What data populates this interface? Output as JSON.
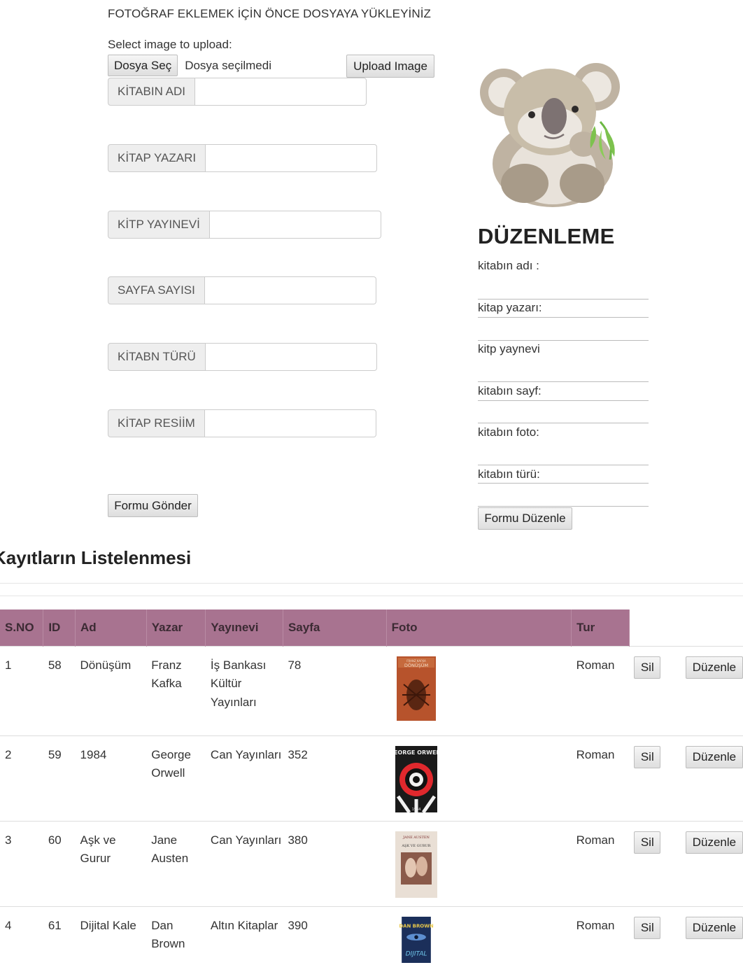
{
  "upload": {
    "note": "FOTOĞRAF EKLEMEK İÇİN ÖNCE DOSYAYA YÜKLEYİNİZ",
    "label": "Select image to upload:",
    "choose_label": "Dosya Seç",
    "file_status": "Dosya seçilmedi",
    "upload_button": "Upload Image"
  },
  "form": {
    "fields": [
      {
        "label": "KİTABIN ADI",
        "value": ""
      },
      {
        "label": "KİTAP YAZARI",
        "value": ""
      },
      {
        "label": "KİTP YAYINEVİ",
        "value": ""
      },
      {
        "label": "SAYFA SAYISI",
        "value": ""
      },
      {
        "label": "KİTABN TÜRÜ",
        "value": ""
      },
      {
        "label": "KİTAP RESİİM",
        "value": ""
      }
    ],
    "submit_label": "Formu Gönder"
  },
  "edit": {
    "title": "DÜZENLEME",
    "labels": [
      "kitabın adı :",
      "kitap yazarı:",
      "kitp yaynevi",
      "kitabın sayf:",
      "kitabın foto:",
      "kitabın türü:"
    ],
    "button_label": "Formu Düzenle"
  },
  "list": {
    "title": "Kayıtların Listelenmesi",
    "columns": [
      "S.NO",
      "ID",
      "Ad",
      "Yazar",
      "Yayınevi",
      "Sayfa",
      "Foto",
      "Tur"
    ],
    "delete_label": "Sil",
    "edit_label": "Düzenle",
    "rows": [
      {
        "sno": "1",
        "id": "58",
        "ad": "Dönüşüm",
        "yazar": "Franz Kafka",
        "yayinevi": "İş Bankası Kültür Yayınları",
        "sayfa": "78",
        "tur": "Roman"
      },
      {
        "sno": "2",
        "id": "59",
        "ad": "1984",
        "yazar": "George Orwell",
        "yayinevi": "Can Yayınları",
        "sayfa": "352",
        "tur": "Roman"
      },
      {
        "sno": "3",
        "id": "60",
        "ad": "Aşk ve Gurur",
        "yazar": "Jane Austen",
        "yayinevi": "Can Yayınları",
        "sayfa": "380",
        "tur": "Roman"
      },
      {
        "sno": "4",
        "id": "61",
        "ad": "Dijital Kale",
        "yazar": "Dan Brown",
        "yayinevi": "Altın Kitaplar",
        "sayfa": "390",
        "tur": "Roman"
      }
    ]
  },
  "colors": {
    "header_bg": "#a87390",
    "addon_bg": "#eeeeee"
  },
  "covers": [
    {
      "title": "DÖNÜŞÜM",
      "author": "FRANZ KAFKA"
    },
    {
      "title": "1984",
      "author": "GEORGE ORWELL"
    },
    {
      "title": "AŞK VE GURUR",
      "author": "JANE AUSTEN"
    },
    {
      "title": "DIJITAL",
      "author": "DAN BROWN"
    }
  ]
}
